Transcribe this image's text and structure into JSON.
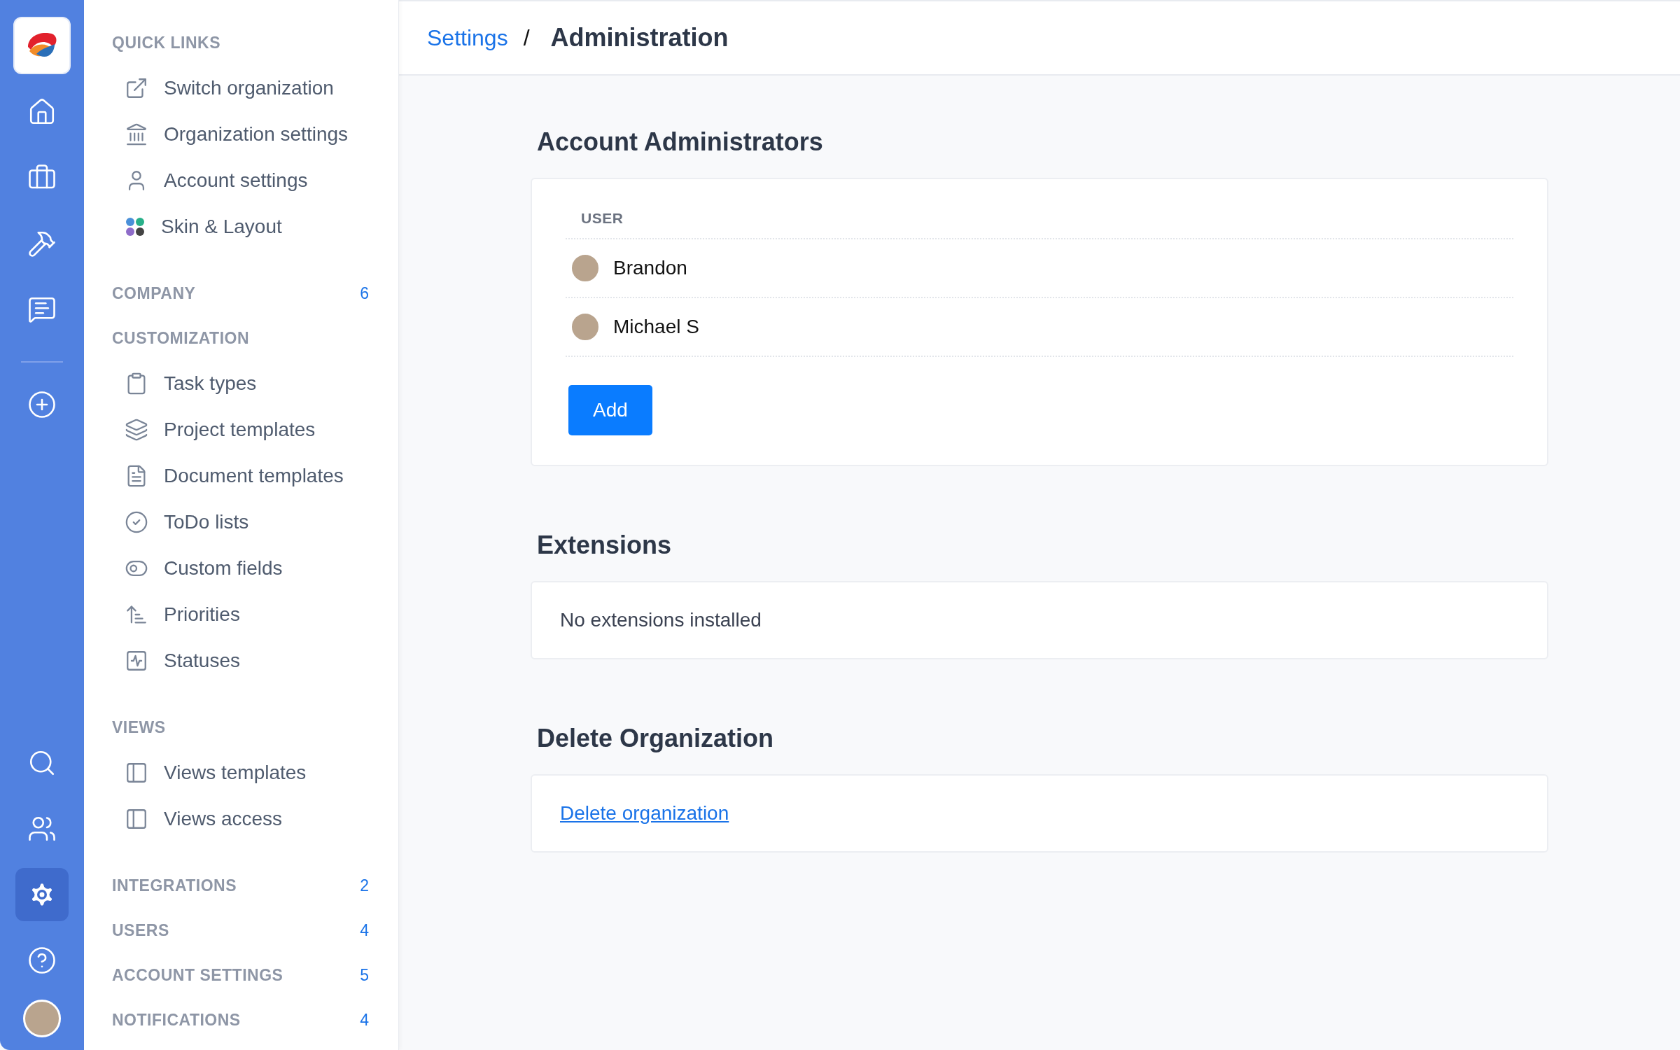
{
  "rail": {
    "top_items": [
      {
        "selected": false
      },
      {
        "selected": false
      },
      {
        "selected": false
      },
      {
        "selected": false
      }
    ],
    "bottom_items": [
      {
        "selected": false
      },
      {
        "selected": false
      },
      {
        "selected": true
      },
      {
        "selected": false
      }
    ]
  },
  "sidebar": {
    "sections": [
      {
        "title": "QUICK LINKS",
        "items": [
          {
            "label": "Switch organization"
          },
          {
            "label": "Organization settings"
          },
          {
            "label": "Account settings"
          },
          {
            "label": "Skin & Layout"
          }
        ]
      },
      {
        "title": "COMPANY",
        "count": "6"
      },
      {
        "title": "CUSTOMIZATION",
        "items": [
          {
            "label": "Task types"
          },
          {
            "label": "Project templates"
          },
          {
            "label": "Document templates"
          },
          {
            "label": "ToDo lists"
          },
          {
            "label": "Custom fields"
          },
          {
            "label": "Priorities"
          },
          {
            "label": "Statuses"
          }
        ]
      },
      {
        "title": "VIEWS",
        "items": [
          {
            "label": "Views templates"
          },
          {
            "label": "Views access"
          }
        ]
      },
      {
        "title": "INTEGRATIONS",
        "count": "2"
      },
      {
        "title": "USERS",
        "count": "4"
      },
      {
        "title": "ACCOUNT SETTINGS",
        "count": "5"
      },
      {
        "title": "NOTIFICATIONS",
        "count": "4"
      }
    ]
  },
  "breadcrumb": {
    "parent": "Settings",
    "separator": "/",
    "current": "Administration"
  },
  "administrators": {
    "title": "Account Administrators",
    "column_header": "USER",
    "users": [
      {
        "name": "Brandon"
      },
      {
        "name": "Michael S"
      }
    ],
    "add_button": "Add"
  },
  "extensions": {
    "title": "Extensions",
    "empty_text": "No extensions installed"
  },
  "delete_organization": {
    "title": "Delete Organization",
    "link": "Delete organization"
  }
}
